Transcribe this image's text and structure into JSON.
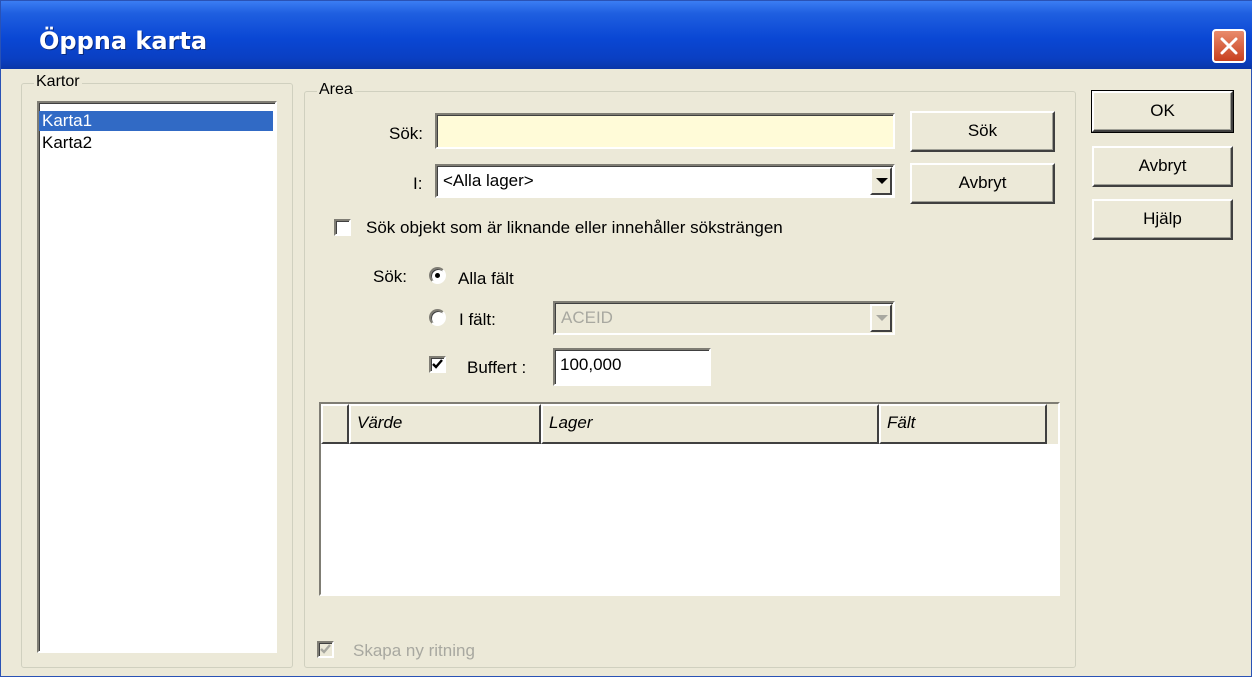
{
  "window": {
    "title": "Öppna karta"
  },
  "maps": {
    "legend": "Kartor",
    "items": [
      {
        "label": "Karta1",
        "selected": true
      },
      {
        "label": "Karta2",
        "selected": false
      }
    ]
  },
  "area": {
    "legend": "Area",
    "search_label": "Sök:",
    "search_value": "",
    "search_button": "Sök",
    "in_label": "I:",
    "in_value": "<Alla lager>",
    "cancel_button": "Avbryt",
    "similar_checkbox_label": "Sök objekt som är liknande eller innehåller söksträngen",
    "similar_checked": false,
    "search_in_label": "Sök:",
    "radio_all_fields": "Alla fält",
    "radio_in_field": "I fält:",
    "radio_selected": "all_fields",
    "field_value": "ACEID",
    "buffer_label": "Buffert :",
    "buffer_checked": true,
    "buffer_value": "100,000",
    "results_columns": [
      "Värde",
      "Lager",
      "Fält"
    ],
    "results_rows": [],
    "create_drawing_label": "Skapa ny ritning",
    "create_drawing_checked": true
  },
  "actions": {
    "ok": "OK",
    "cancel": "Avbryt",
    "help": "Hjälp"
  },
  "colors": {
    "titlebar": "#0a47d4",
    "selection": "#316ac5",
    "dialog_bg": "#ece9d8",
    "search_field": "#fffbd8",
    "close_button": "#d6542d"
  },
  "icons": {
    "close": "close-icon",
    "checkmark": "checkmark-icon",
    "dropdown": "chevron-down-icon"
  }
}
